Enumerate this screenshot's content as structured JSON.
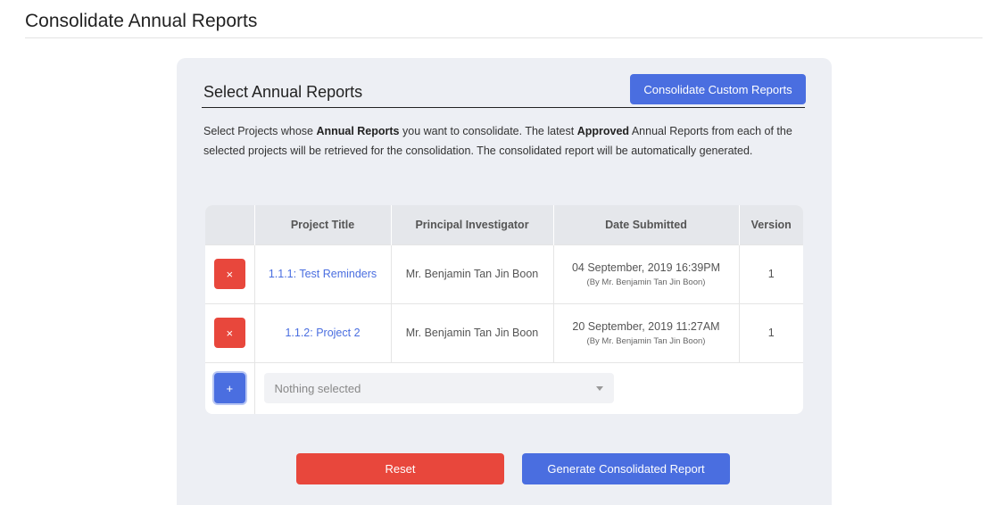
{
  "page": {
    "title": "Consolidate Annual Reports"
  },
  "card": {
    "title": "Select Annual Reports",
    "custom_button": "Consolidate Custom Reports",
    "description": {
      "p1": "Select Projects whose ",
      "b1": "Annual Reports",
      "p2": " you want to consolidate. The latest ",
      "b2": "Approved",
      "p3": " Annual Reports from each of the selected projects will be retrieved for the consolidation. The consolidated report will be automatically generated."
    }
  },
  "table": {
    "headers": [
      "",
      "Project Title",
      "Principal Investigator",
      "Date Submitted",
      "Version"
    ],
    "rows": [
      {
        "remove": "×",
        "title": "1.1.1: Test Reminders",
        "pi": "Mr. Benjamin Tan Jin Boon",
        "date": "04 September, 2019 16:39PM",
        "by": "(By Mr. Benjamin Tan Jin Boon)",
        "version": "1"
      },
      {
        "remove": "×",
        "title": "1.1.2: Project 2",
        "pi": "Mr. Benjamin Tan Jin Boon",
        "date": "20 September, 2019 11:27AM",
        "by": "(By Mr. Benjamin Tan Jin Boon)",
        "version": "1"
      }
    ],
    "add_button": "+",
    "select_placeholder": "Nothing selected"
  },
  "actions": {
    "reset": "Reset",
    "generate": "Generate Consolidated Report"
  },
  "colors": {
    "primary": "#4a6ee0",
    "danger": "#e8473c",
    "card_bg": "#edeff4"
  }
}
